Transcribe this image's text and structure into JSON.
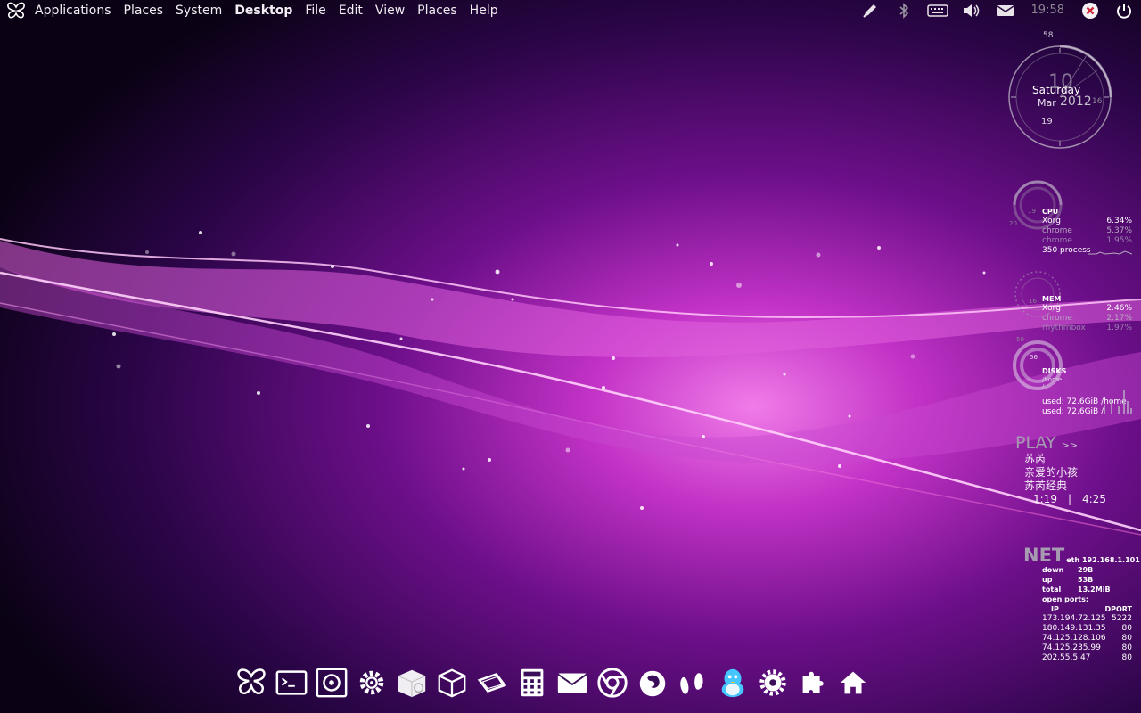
{
  "topbar": {
    "menus": [
      "Applications",
      "Places",
      "System",
      "Desktop",
      "File",
      "Edit",
      "View",
      "Places",
      "Help"
    ],
    "active_app": "Desktop",
    "tray_icons": [
      "pen-icon",
      "bluetooth-icon",
      "keyboard-icon",
      "volume-icon",
      "mail-icon"
    ],
    "clock": "19:58",
    "close_icon": "close-circle-icon",
    "power_icon": "power-icon"
  },
  "clock_widget": {
    "seconds": "58",
    "day_number": "10",
    "weekday": "Saturday",
    "month": "Mar",
    "year": "2012",
    "minutes_mark": "16",
    "hour_mark": "19"
  },
  "cpu": {
    "title": "CPU",
    "dial_hi": "19",
    "dial_lo": "20",
    "procs": [
      {
        "name": "Xorg",
        "value": "6.34%"
      },
      {
        "name": "chrome",
        "value": "5.37%"
      },
      {
        "name": "chrome",
        "value": "1.95%"
      }
    ],
    "process_count": "350 process"
  },
  "mem": {
    "title": "MEM",
    "dial_mark": "16",
    "procs": [
      {
        "name": "Xorg",
        "value": "2.46%"
      },
      {
        "name": "chrome",
        "value": "2.17%"
      },
      {
        "name": "rhythmbox",
        "value": "1.97%"
      }
    ]
  },
  "disks": {
    "title": "DISKS",
    "dial_hi": "50",
    "dial_lo": "56",
    "mounts": [
      "/home",
      "/"
    ],
    "used_home": "used: 72.6GiB /home",
    "used_root": "used: 72.6GiB /"
  },
  "player": {
    "label": "PLAY",
    "arrow": ">>",
    "artist": "苏芮",
    "track": "亲爱的小孩",
    "album": "苏芮经典",
    "elapsed": "1:19",
    "separator": "|",
    "total": "4:25"
  },
  "net": {
    "label": "NET",
    "iface": "eth 192.168.1.101",
    "down_label": "down",
    "down": "29B",
    "up_label": "up",
    "up": "53B",
    "total_label": "total",
    "total": "13.2MiB",
    "open_ports_label": "open ports:",
    "col_ip": "IP",
    "col_port": "DPORT",
    "ports": [
      {
        "ip": "173.194.72.125",
        "port": "5222"
      },
      {
        "ip": "180.149.131.35",
        "port": "80"
      },
      {
        "ip": "74.125.128.106",
        "port": "80"
      },
      {
        "ip": "74.125.235.99",
        "port": "80"
      },
      {
        "ip": "202.55.5.47",
        "port": "80"
      }
    ]
  },
  "dock": {
    "icons": [
      "butterfly-icon",
      "terminal-icon",
      "monitor-icon",
      "settings-gear-icon",
      "disk-drive-icon",
      "package-icon",
      "image-viewer-icon",
      "calculator-icon",
      "mail-icon",
      "chrome-icon",
      "firefox-icon",
      "feet-icon",
      "qq-penguin-icon",
      "system-settings-icon",
      "puzzle-icon",
      "home-icon"
    ]
  }
}
